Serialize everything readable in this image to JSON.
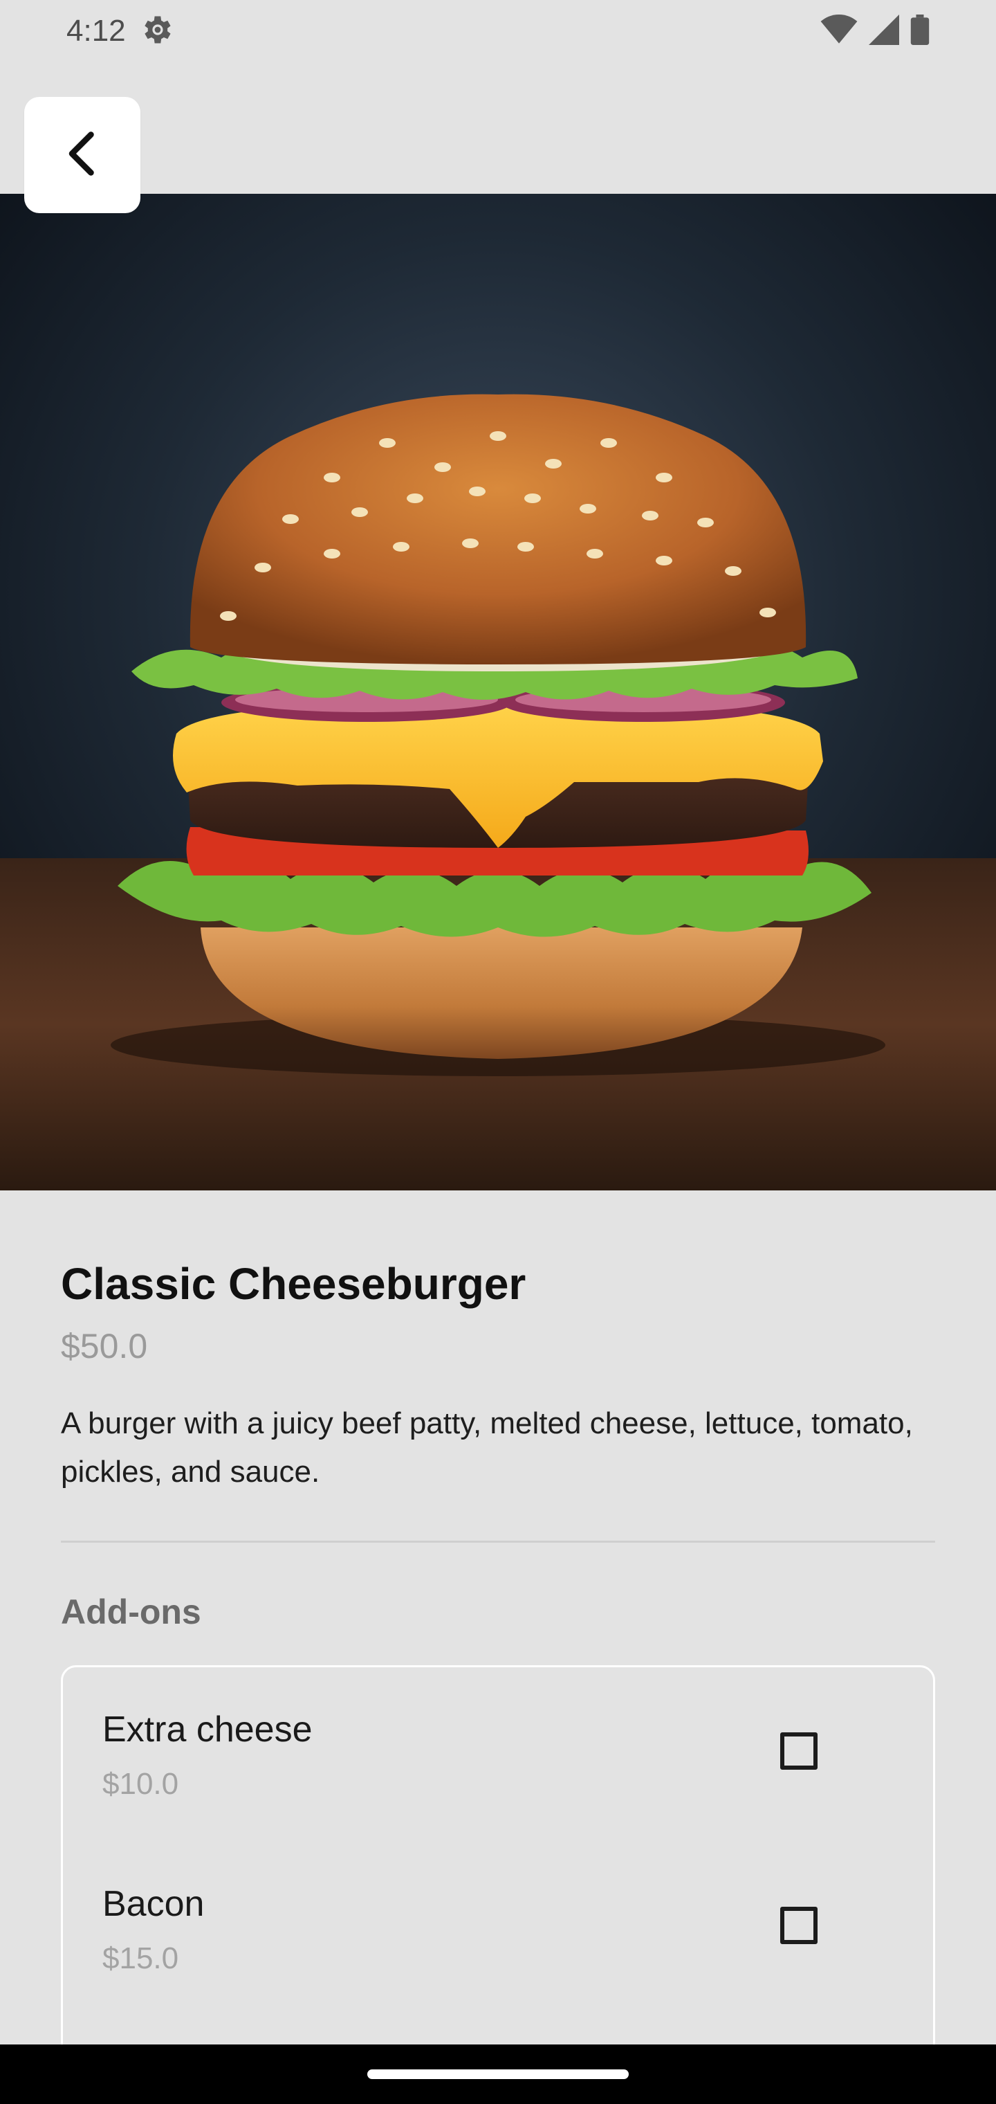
{
  "status_bar": {
    "time": "4:12",
    "settings_icon": "gear-icon",
    "wifi_icon": "wifi-icon",
    "signal_icon": "signal-icon",
    "battery_icon": "battery-icon"
  },
  "header": {
    "back_icon": "chevron-left-icon"
  },
  "hero": {
    "image": "cheeseburger-photo"
  },
  "product": {
    "title": "Classic Cheeseburger",
    "price": "$50.0",
    "description": "A burger with a juicy beef patty, melted cheese, lettuce, tomato, pickles, and sauce."
  },
  "addons": {
    "section_title": "Add-ons",
    "items": [
      {
        "name": "Extra cheese",
        "price": "$10.0",
        "checked": false
      },
      {
        "name": "Bacon",
        "price": "$15.0",
        "checked": false
      }
    ]
  },
  "colors": {
    "background": "#e3e3e3",
    "card_border": "#ffffff",
    "muted_text": "#9a9a9a",
    "nav_bar": "#000000"
  }
}
